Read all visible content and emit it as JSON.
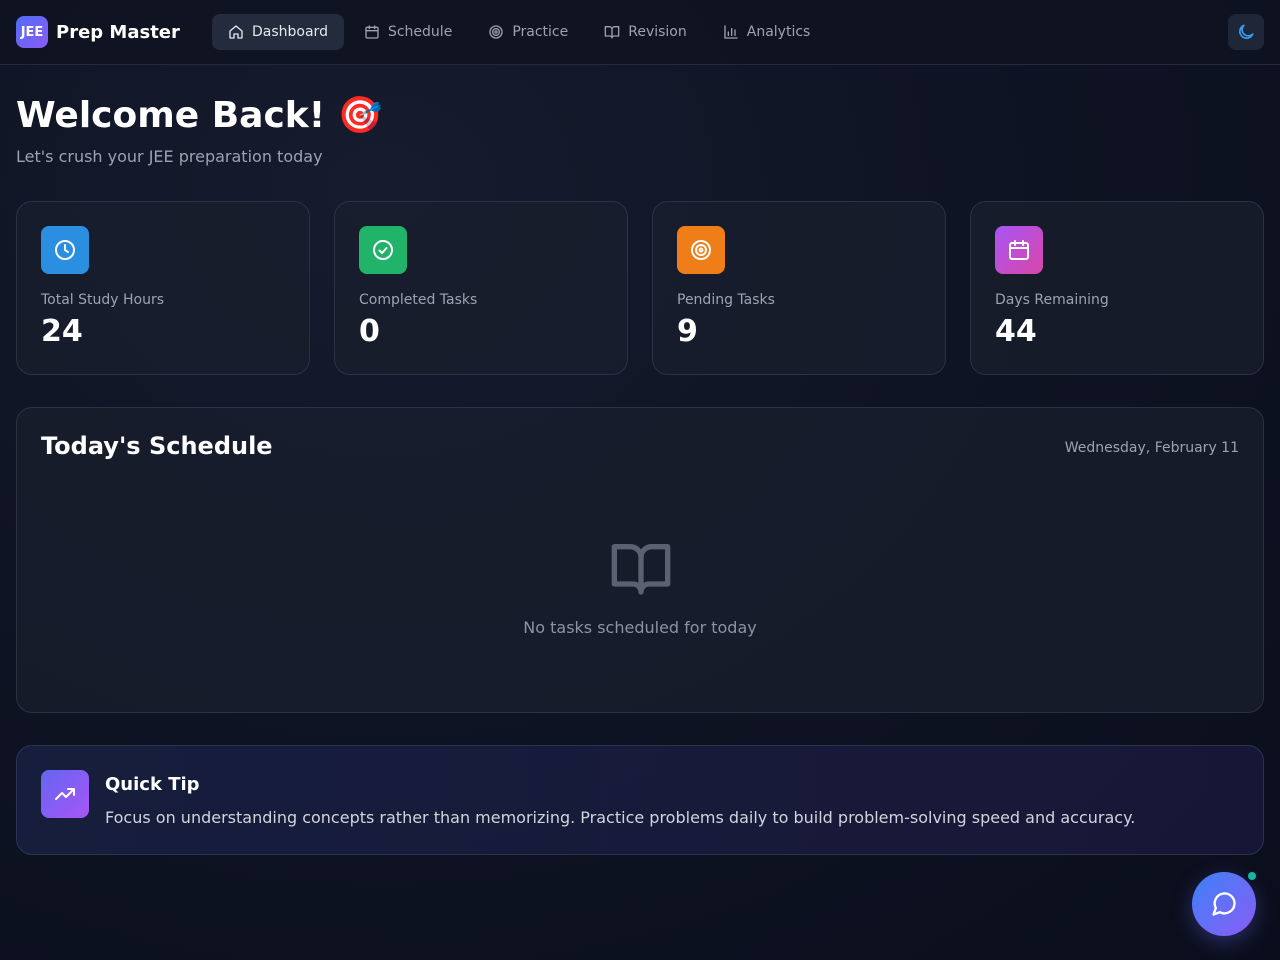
{
  "brand": {
    "logo_text": "JEE",
    "name": "Prep Master"
  },
  "nav": {
    "tabs": [
      {
        "label": "Dashboard",
        "icon": "home-icon",
        "active": true
      },
      {
        "label": "Schedule",
        "icon": "calendar-icon",
        "active": false
      },
      {
        "label": "Practice",
        "icon": "target-icon",
        "active": false
      },
      {
        "label": "Revision",
        "icon": "book-open-icon",
        "active": false
      },
      {
        "label": "Analytics",
        "icon": "bar-chart-icon",
        "active": false
      }
    ],
    "theme_icon": "moon-icon"
  },
  "welcome": {
    "title": "Welcome Back! 🎯",
    "subtitle": "Let's crush your JEE preparation today"
  },
  "stats": [
    {
      "label": "Total Study Hours",
      "value": "24",
      "icon": "clock-icon",
      "color": "#2a8fe0"
    },
    {
      "label": "Completed Tasks",
      "value": "0",
      "icon": "check-circle-icon",
      "color": "#22b36a"
    },
    {
      "label": "Pending Tasks",
      "value": "9",
      "icon": "target-icon",
      "color": "#f07e18"
    },
    {
      "label": "Days Remaining",
      "value": "44",
      "icon": "calendar-icon",
      "color": "#c24fd6"
    }
  ],
  "schedule": {
    "title": "Today's Schedule",
    "date": "Wednesday, February 11",
    "empty_icon": "book-open-icon",
    "empty_text": "No tasks scheduled for today"
  },
  "tip": {
    "icon": "trending-up-icon",
    "title": "Quick Tip",
    "text": "Focus on understanding concepts rather than memorizing. Practice problems daily to build problem-solving speed and accuracy."
  },
  "chat": {
    "icon": "message-circle-icon",
    "status_color": "#14b8a6"
  },
  "colors": {
    "accent": "#6366f1",
    "background": "#0f1424",
    "card": "#1a1f2e"
  }
}
